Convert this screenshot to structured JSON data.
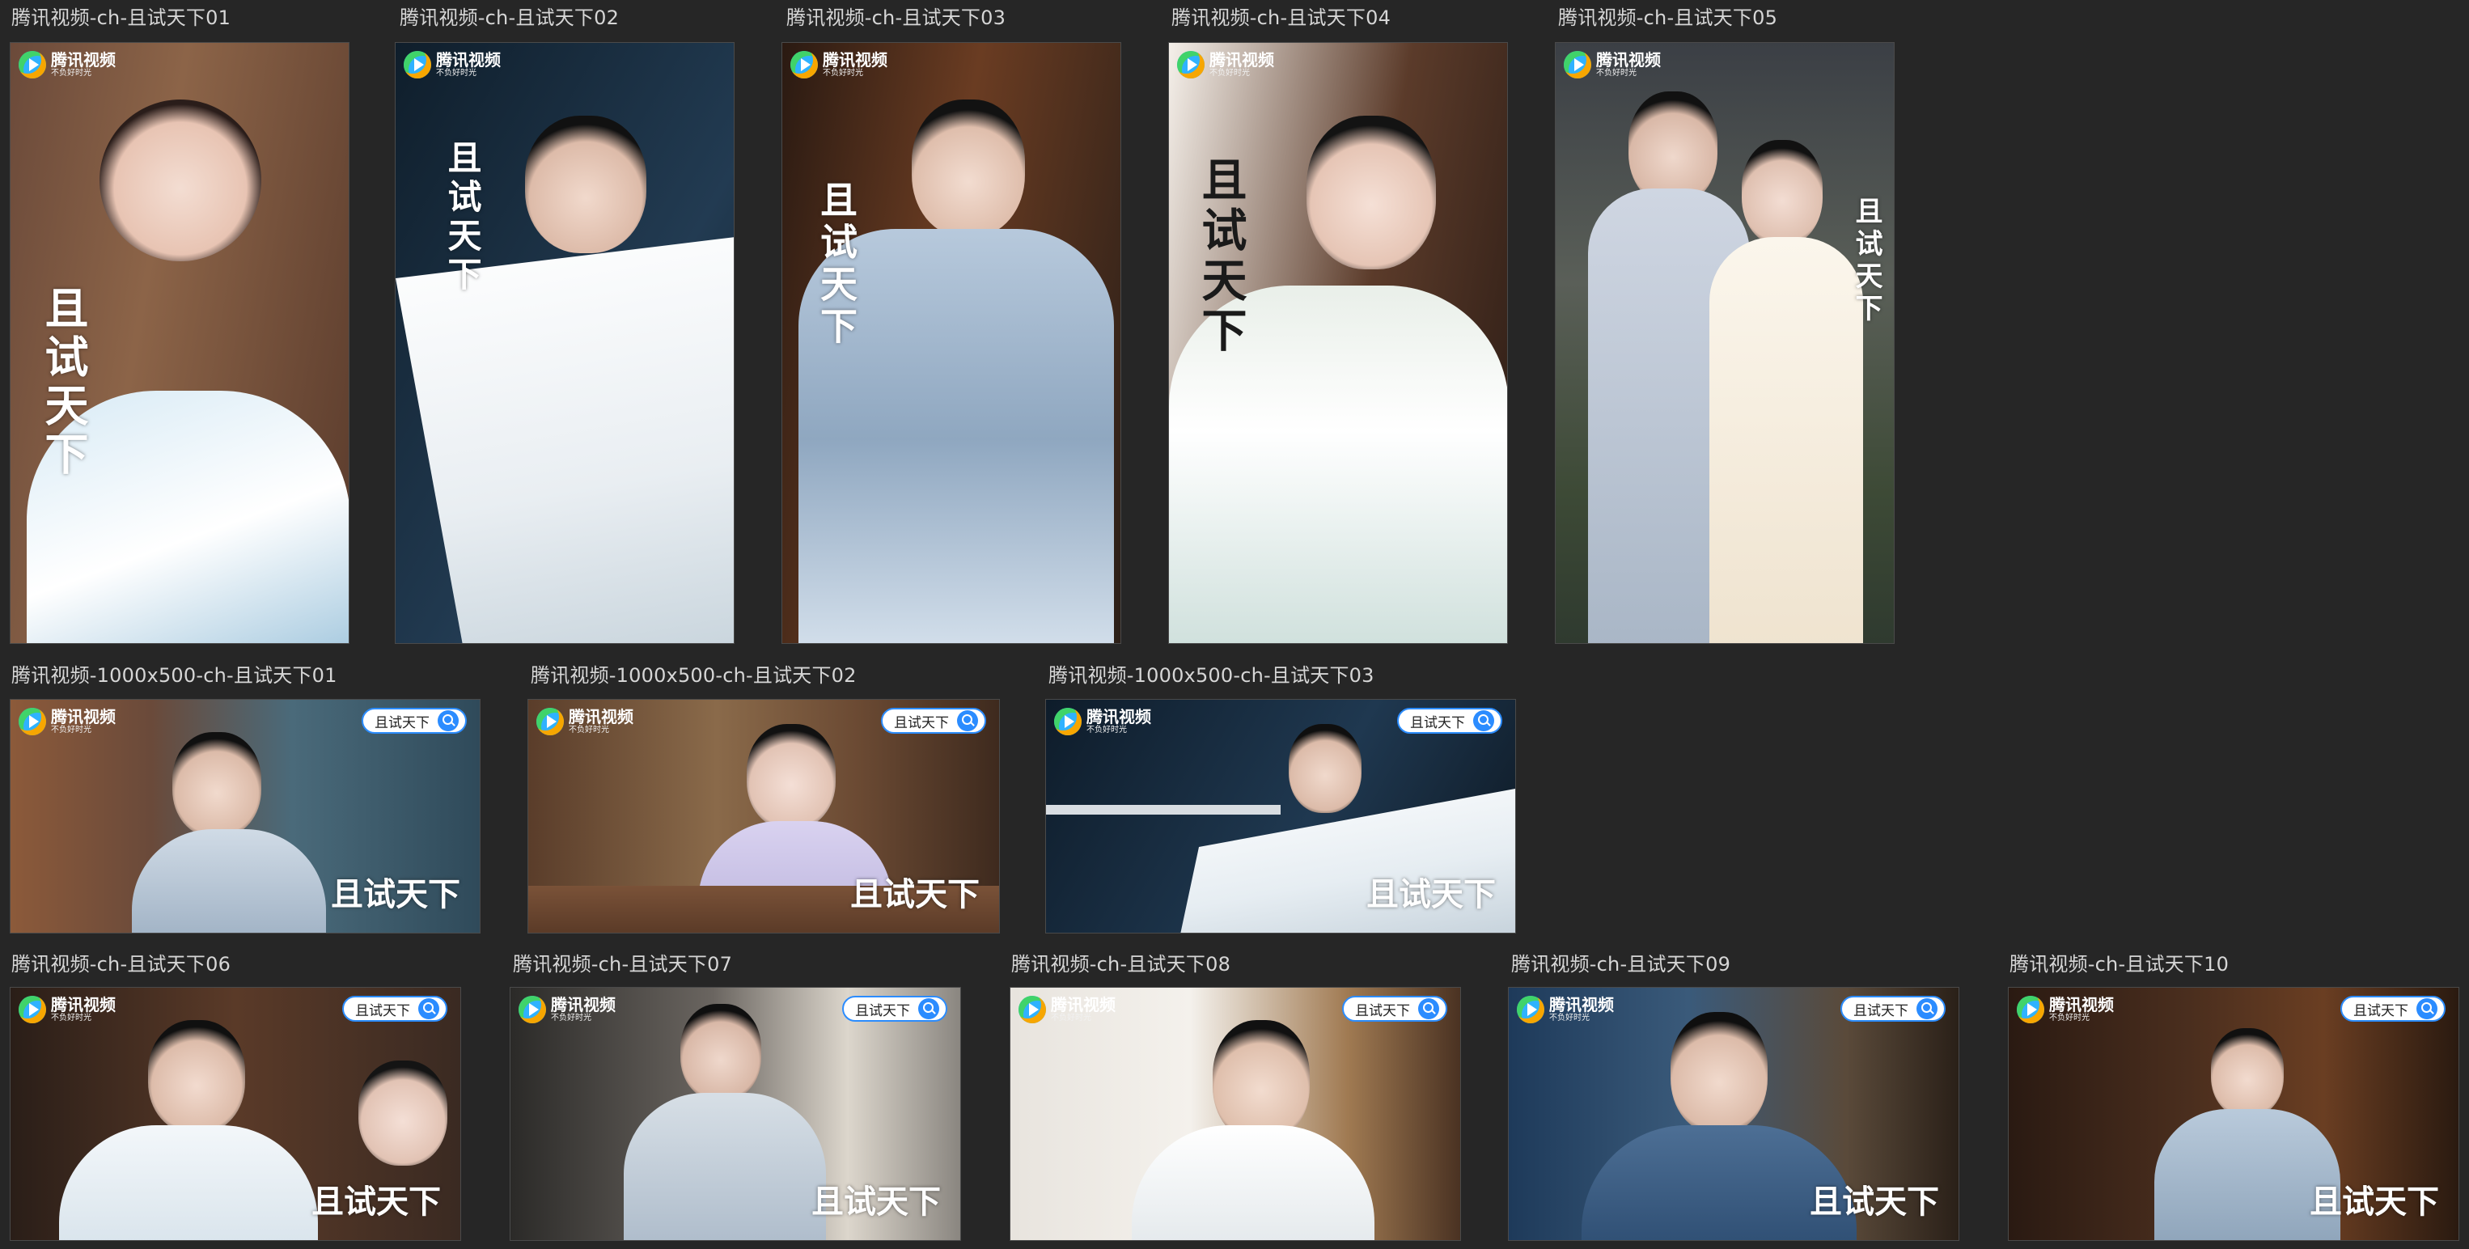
{
  "gallery": {
    "row1": [
      {
        "label": "腾讯视频-ch-且试天下01"
      },
      {
        "label": "腾讯视频-ch-且试天下02"
      },
      {
        "label": "腾讯视频-ch-且试天下03"
      },
      {
        "label": "腾讯视频-ch-且试天下04"
      },
      {
        "label": "腾讯视频-ch-且试天下05"
      }
    ],
    "row2": [
      {
        "label": "腾讯视频-1000x500-ch-且试天下01"
      },
      {
        "label": "腾讯视频-1000x500-ch-且试天下02"
      },
      {
        "label": "腾讯视频-1000x500-ch-且试天下03"
      }
    ],
    "row3": [
      {
        "label": "腾讯视频-ch-且试天下06"
      },
      {
        "label": "腾讯视频-ch-且试天下07"
      },
      {
        "label": "腾讯视频-ch-且试天下08"
      },
      {
        "label": "腾讯视频-ch-且试天下09"
      },
      {
        "label": "腾讯视频-ch-且试天下10"
      }
    ]
  },
  "poster": {
    "logo_name": "腾讯视频",
    "logo_slogan": "不负好时光",
    "search_text": "且试天下",
    "title_art": "且试天下"
  },
  "colors": {
    "background": "#262626",
    "search_accent": "#2b8cff"
  }
}
